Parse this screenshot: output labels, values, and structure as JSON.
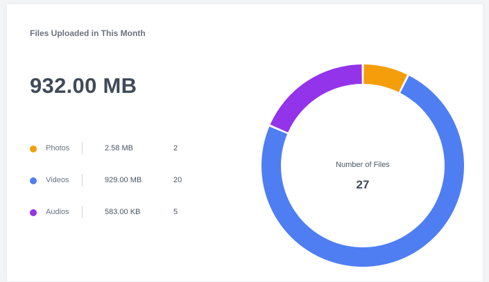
{
  "card": {
    "title": "Files Uploaded in This Month",
    "total": "932.00 MB"
  },
  "legend": [
    {
      "name": "Photos",
      "size": "2.58 MB",
      "count": "2",
      "color": "#f59e0b"
    },
    {
      "name": "Videos",
      "size": "929.00 MB",
      "count": "20",
      "color": "#4f7ef3"
    },
    {
      "name": "Audios",
      "size": "583.00 KB",
      "count": "5",
      "color": "#9333ea"
    }
  ],
  "donut": {
    "center_label": "Number of Files",
    "center_value": "27"
  },
  "chart_data": {
    "type": "pie",
    "categories": [
      "Photos",
      "Videos",
      "Audios"
    ],
    "values": [
      2,
      20,
      5
    ],
    "colors": [
      "#f59e0b",
      "#4f7ef3",
      "#9333ea"
    ],
    "title": "",
    "legend": "left"
  }
}
